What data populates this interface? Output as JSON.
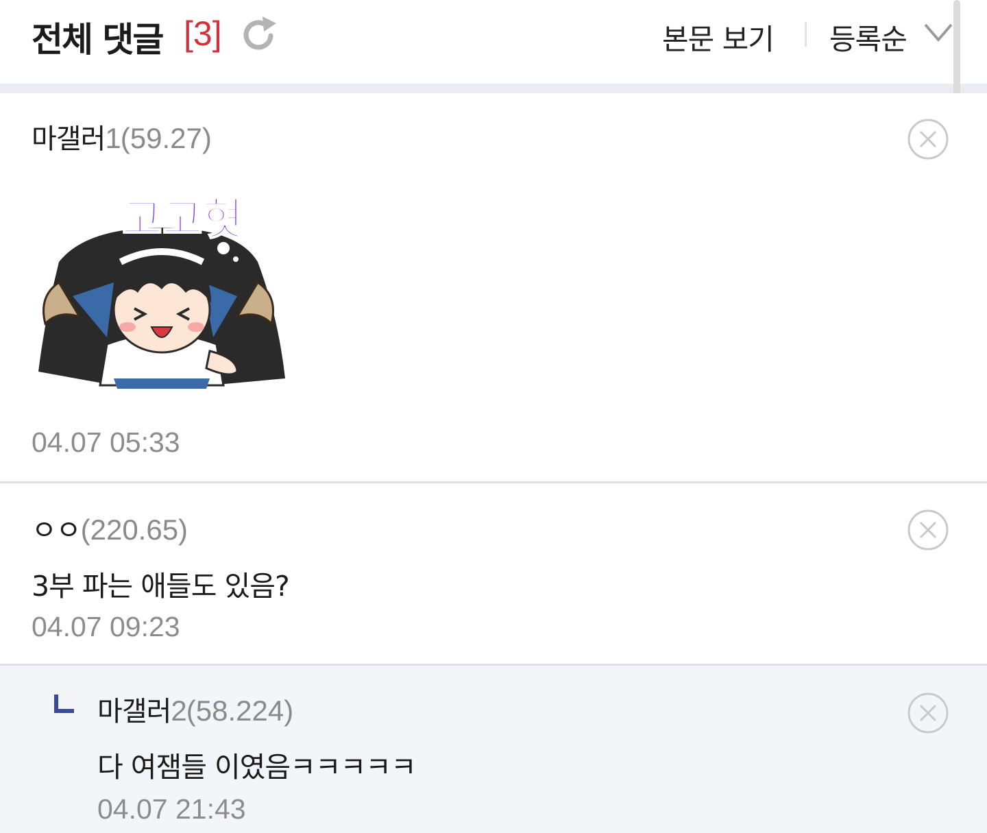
{
  "header": {
    "title": "전체 댓글",
    "count": "[3]",
    "view_body_label": "본문 보기",
    "sort_label": "등록순",
    "icons": [
      "refresh-icon",
      "chevron-down-icon"
    ]
  },
  "comments": [
    {
      "nickname": "마갤러",
      "nick_number": "1",
      "ip": "(59.27)",
      "sticker_text": "고고혓",
      "date": "04.07 05:33",
      "icon": "delete-circle-icon"
    },
    {
      "nickname": "ㅇㅇ",
      "ip": "(220.65)",
      "text": "3부 파는 애들도 있음?",
      "date": "04.07 09:23",
      "icon": "delete-circle-icon"
    },
    {
      "reply": true,
      "nickname": "마갤러",
      "nick_number": "2",
      "ip": "(58.224)",
      "text": "다 여잼들 이였음ㅋㅋㅋㅋㅋ",
      "date": "04.07 21:43",
      "icon": "delete-circle-icon"
    }
  ],
  "colors": {
    "count": "#d0313a",
    "muted": "#8a8a8a",
    "reply_bg": "#f4f5f9",
    "sticker_text": "#7b2cf0",
    "reply_mark": "#3a4a9a"
  }
}
